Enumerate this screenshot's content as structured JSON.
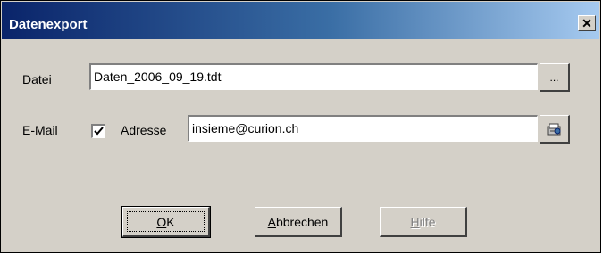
{
  "window": {
    "title": "Datenexport",
    "close_glyph": "✕"
  },
  "file": {
    "label": "Datei",
    "value": "Daten_2006_09_19.tdt",
    "browse_label": "..."
  },
  "email": {
    "label": "E-Mail",
    "checked": true,
    "address_label": "Adresse",
    "address_value": "insieme@curion.ch",
    "addressbook_icon": "address-book-icon"
  },
  "buttons": {
    "ok_mnemonic": "O",
    "ok_rest": "K",
    "cancel_mnemonic": "A",
    "cancel_rest": "bbrechen",
    "help_mnemonic": "H",
    "help_rest": "ilfe"
  }
}
